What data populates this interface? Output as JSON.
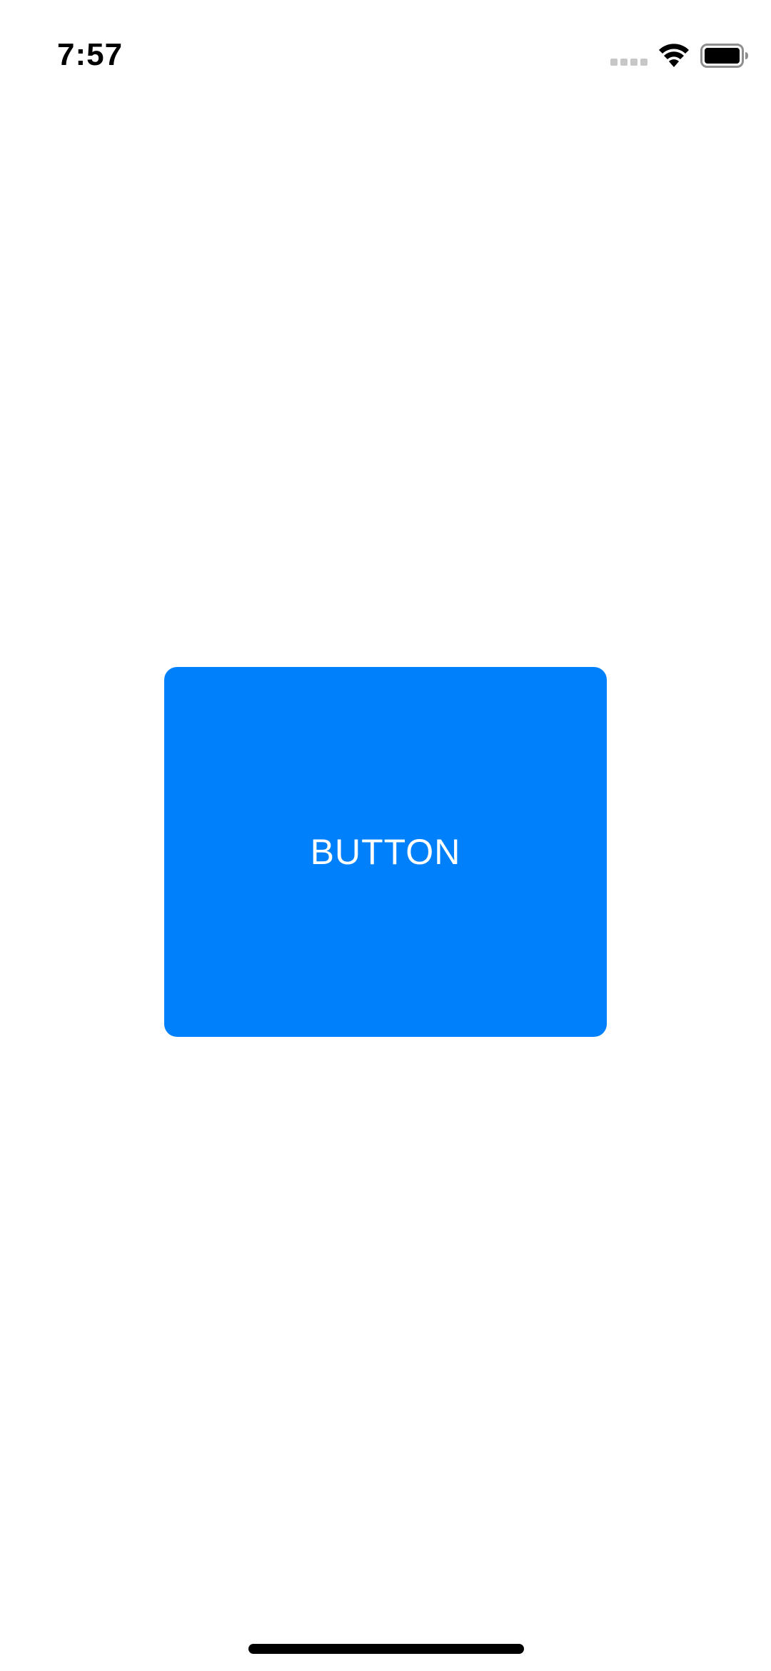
{
  "status_bar": {
    "time": "7:57",
    "signal_icon": "cellular-signal-icon",
    "wifi_icon": "wifi-icon",
    "battery_icon": "battery-icon"
  },
  "main": {
    "button_label": "BUTTON",
    "button_color": "#0080fb"
  },
  "home_indicator": {
    "icon": "home-indicator-bar"
  }
}
